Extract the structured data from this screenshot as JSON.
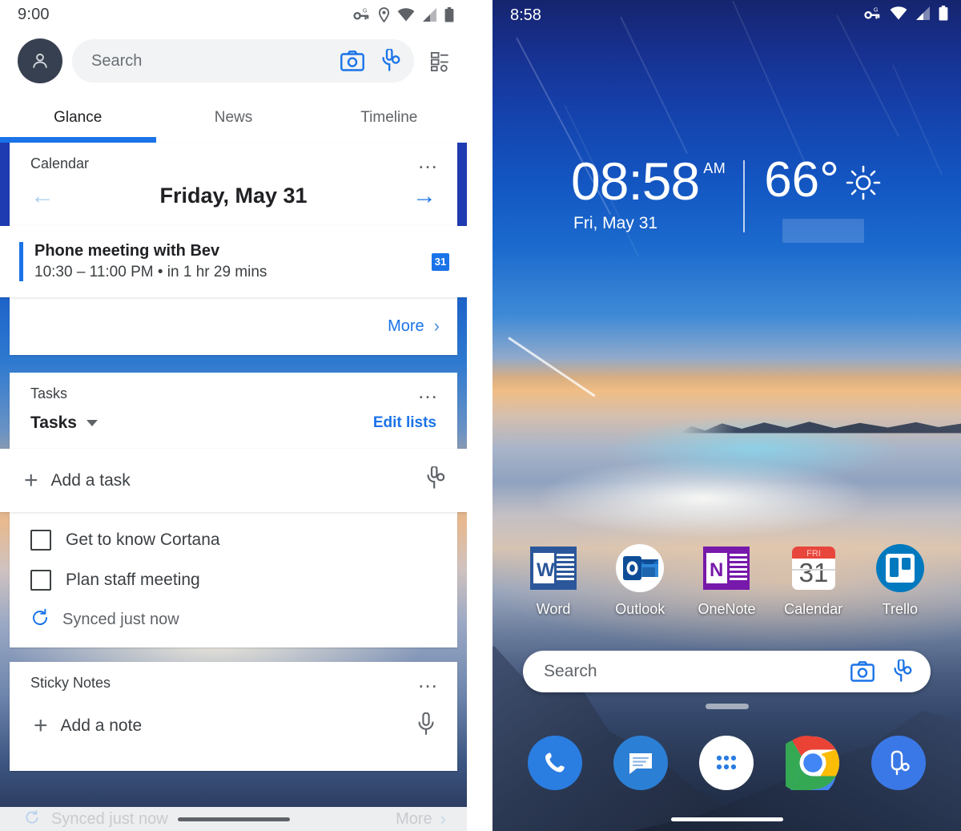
{
  "left": {
    "statusbar": {
      "time": "9:00",
      "icons": [
        "vpn-key-icon",
        "location-pin-icon",
        "wifi-icon",
        "cellular-signal-icon",
        "battery-icon"
      ]
    },
    "search": {
      "placeholder": "Search",
      "camera_icon": "camera-icon",
      "cortana_icon": "cortana-mic-icon",
      "settings_icon": "list-settings-icon"
    },
    "tabs": [
      {
        "label": "Glance",
        "active": true
      },
      {
        "label": "News",
        "active": false
      },
      {
        "label": "Timeline",
        "active": false
      }
    ],
    "calendar_card": {
      "title": "Calendar",
      "overflow": "…",
      "date": "Friday, May 31",
      "prev_arrow": "←",
      "next_arrow": "→",
      "event": {
        "title": "Phone meeting with Bev",
        "subtitle": "10:30 – 11:00 PM • in 1 hr 29 mins",
        "badge": "31"
      },
      "more_label": "More"
    },
    "tasks_card": {
      "title": "Tasks",
      "overflow": "…",
      "list_name": "Tasks",
      "edit_lists": "Edit lists",
      "add_label": "Add a task",
      "items": [
        {
          "label": "Get to know Cortana",
          "checked": false
        },
        {
          "label": "Plan staff meeting",
          "checked": false
        }
      ],
      "sync_status": "Synced just now"
    },
    "sticky_card": {
      "title": "Sticky Notes",
      "overflow": "…",
      "add_label": "Add a note"
    },
    "ghost": {
      "sync_status": "Synced just now",
      "more_label": "More"
    }
  },
  "right": {
    "statusbar": {
      "time": "8:58",
      "icons": [
        "vpn-key-icon",
        "wifi-icon",
        "cellular-signal-icon",
        "battery-icon"
      ]
    },
    "clock_widget": {
      "time": "08:58",
      "ampm": "AM",
      "date": "Fri, May 31",
      "temperature": "66°",
      "weather_icon": "sunny-icon"
    },
    "apps": [
      {
        "label": "Word",
        "icon": "word-icon"
      },
      {
        "label": "Outlook",
        "icon": "outlook-icon"
      },
      {
        "label": "OneNote",
        "icon": "onenote-icon"
      },
      {
        "label": "Calendar",
        "icon": "calendar-icon",
        "day": "FRI",
        "date": "31"
      },
      {
        "label": "Trello",
        "icon": "trello-icon"
      }
    ],
    "search": {
      "placeholder": "Search",
      "camera_icon": "camera-icon",
      "cortana_icon": "cortana-mic-icon"
    },
    "dock": [
      {
        "icon": "phone-icon"
      },
      {
        "icon": "messages-icon"
      },
      {
        "icon": "app-drawer-icon"
      },
      {
        "icon": "chrome-icon"
      },
      {
        "icon": "cortana-icon"
      }
    ]
  },
  "colors": {
    "accent_blue": "#1a73e8",
    "cortana_border_blue": "#1f3bb2",
    "word_blue": "#2b579a",
    "onenote_purple": "#7719aa",
    "trello_blue": "#0079bf",
    "outlook_blue": "#0f6cbd"
  }
}
